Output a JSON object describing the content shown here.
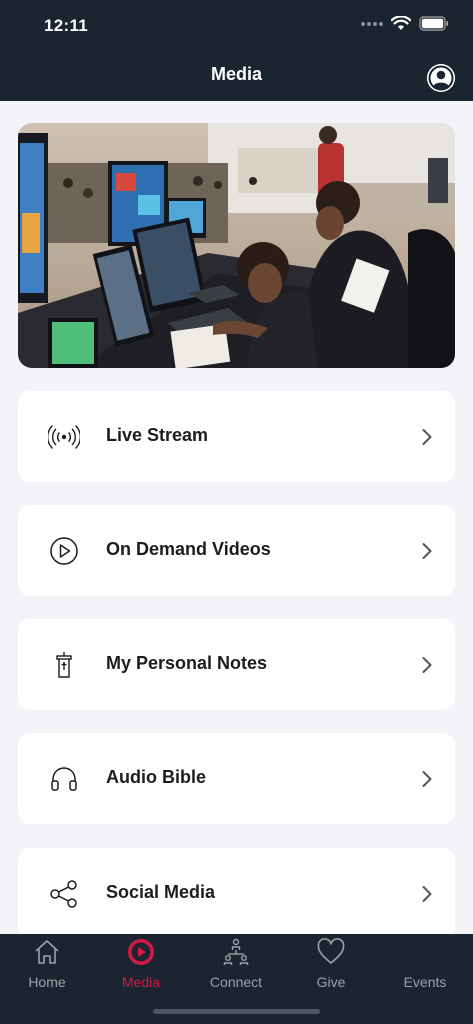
{
  "status_bar": {
    "time": "12:11"
  },
  "nav": {
    "title": "Media"
  },
  "hero": {
    "image": "photo-control-room-media-team"
  },
  "menu": [
    {
      "label": "Live Stream",
      "icon": "broadcast-icon"
    },
    {
      "label": "On Demand Videos",
      "icon": "play-circle-icon"
    },
    {
      "label": "My Personal Notes",
      "icon": "pulpit-icon"
    },
    {
      "label": "Audio Bible",
      "icon": "headphones-icon"
    },
    {
      "label": "Social Media",
      "icon": "share-icon"
    }
  ],
  "tabs": [
    {
      "label": "Home",
      "icon": "home-icon",
      "active": false
    },
    {
      "label": "Media",
      "icon": "play-circle-filled-icon",
      "active": true
    },
    {
      "label": "Connect",
      "icon": "people-connect-icon",
      "active": false
    },
    {
      "label": "Give",
      "icon": "heart-icon",
      "active": false
    },
    {
      "label": "Events",
      "icon": "",
      "active": false
    }
  ],
  "colors": {
    "header_bg": "#1b2530",
    "accent": "#d41942",
    "page_bg": "#f3f4f7",
    "inactive_tab": "#9aa1a9"
  }
}
